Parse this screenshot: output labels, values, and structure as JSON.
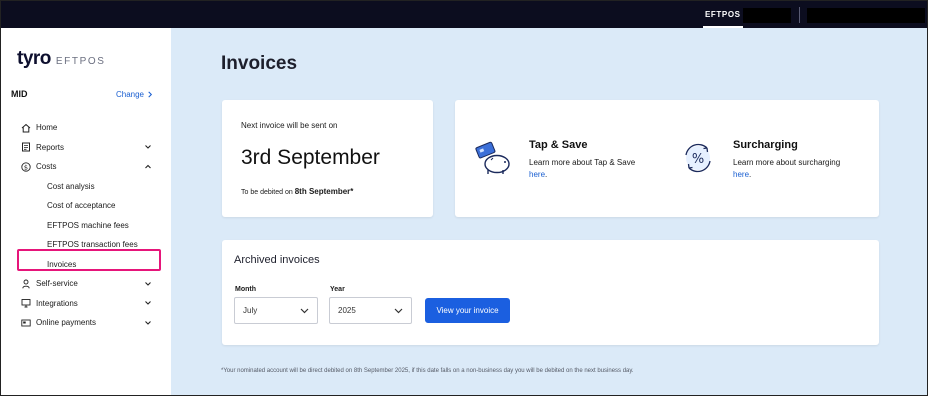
{
  "topbar": {
    "active_tab": "EFTPOS"
  },
  "sidebar": {
    "logo_text": "tyro",
    "logo_sub": "EFTPOS",
    "mid_label": "MID",
    "change_label": "Change",
    "items": [
      {
        "label": "Home",
        "icon": "home-icon"
      },
      {
        "label": "Reports",
        "icon": "reports-icon"
      },
      {
        "label": "Costs",
        "icon": "dollar-icon"
      },
      {
        "label": "Cost analysis"
      },
      {
        "label": "Cost of acceptance"
      },
      {
        "label": "EFTPOS machine fees"
      },
      {
        "label": "EFTPOS transaction fees"
      },
      {
        "label": "Invoices"
      },
      {
        "label": "Self-service",
        "icon": "person-icon"
      },
      {
        "label": "Integrations",
        "icon": "monitor-icon"
      },
      {
        "label": "Online payments",
        "icon": "card-icon"
      }
    ],
    "highlight_color": "#e6157a"
  },
  "main": {
    "title": "Invoices",
    "next_invoice": {
      "intro": "Next invoice will be sent on",
      "date": "3rd September",
      "debit_prefix": "To be debited on",
      "debit_date": "8th September*"
    },
    "promos": [
      {
        "title": "Tap & Save",
        "desc": "Learn more about Tap & Save",
        "link": "here",
        "icon": "piggy-bank-card-icon"
      },
      {
        "title": "Surcharging",
        "desc": "Learn more about surcharging",
        "link": "here",
        "icon": "percent-cycle-icon"
      }
    ],
    "archived": {
      "title": "Archived invoices",
      "month_label": "Month",
      "month_value": "July",
      "year_label": "Year",
      "year_value": "2025",
      "button_label": "View your invoice"
    },
    "footnote": "*Your nominated account will be direct debited on 8th September 2025, if this date falls on a non-business day you will be debited on the next business day."
  },
  "colors": {
    "accent": "#1b5fe0",
    "link": "#1a5fd1",
    "topbar": "#0c0d1f",
    "main_bg": "#dbeaf8"
  }
}
